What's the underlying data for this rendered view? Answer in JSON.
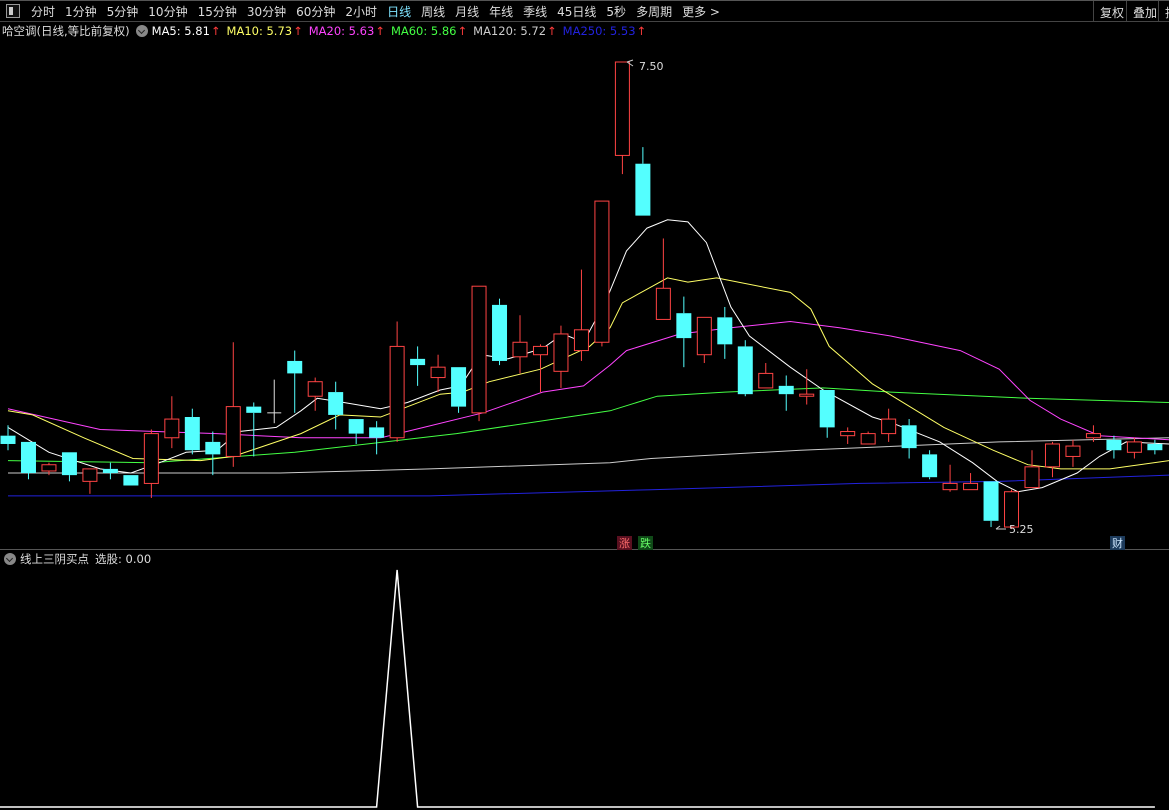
{
  "toolbar": {
    "periods": [
      "分时",
      "1分钟",
      "5分钟",
      "10分钟",
      "15分钟",
      "30分钟",
      "60分钟",
      "2小时",
      "日线",
      "周线",
      "月线",
      "年线",
      "季线",
      "45日线",
      "5秒",
      "多周期",
      "更多 >"
    ],
    "active_period": "日线",
    "right_buttons": [
      "复权",
      "叠加",
      "指"
    ]
  },
  "legend": {
    "title": "哈空调(日线,等比前复权)",
    "ma": [
      {
        "label": "MA5: 5.81",
        "color": "#ffffff"
      },
      {
        "label": "MA10: 5.73",
        "color": "#ffff66"
      },
      {
        "label": "MA20: 5.63",
        "color": "#ff44ff"
      },
      {
        "label": "MA60: 5.86",
        "color": "#44ff44"
      },
      {
        "label": "MA120: 5.72",
        "color": "#cccccc"
      },
      {
        "label": "MA250: 5.53",
        "color": "#2222dd"
      }
    ],
    "arrow": "↑"
  },
  "annotations": {
    "high": "7.50",
    "low": "5.25",
    "rise": "涨",
    "fall": "跌",
    "finance": "财"
  },
  "sub_legend": {
    "name": "线上三阴买点",
    "value": "选股: 0.00"
  },
  "colors": {
    "up": "#ff4444",
    "down": "#54ffff",
    "doji": "#dddddd"
  },
  "chart_data": {
    "type": "candlestick",
    "price_range": [
      5.25,
      7.5
    ],
    "candles": [
      [
        5.7,
        5.75,
        5.63,
        5.66
      ],
      [
        5.67,
        5.67,
        5.49,
        5.52
      ],
      [
        5.53,
        5.57,
        5.51,
        5.56
      ],
      [
        5.62,
        5.62,
        5.48,
        5.51
      ],
      [
        5.48,
        5.54,
        5.42,
        5.54
      ],
      [
        5.54,
        5.57,
        5.49,
        5.52
      ],
      [
        5.51,
        5.51,
        5.46,
        5.46
      ],
      [
        5.47,
        5.73,
        5.4,
        5.71
      ],
      [
        5.69,
        5.89,
        5.64,
        5.78
      ],
      [
        5.79,
        5.83,
        5.61,
        5.63
      ],
      [
        5.67,
        5.72,
        5.51,
        5.61
      ],
      [
        5.6,
        6.15,
        5.55,
        5.84
      ],
      [
        5.84,
        5.86,
        5.6,
        5.81
      ],
      [
        5.81,
        5.97,
        5.76,
        5.81
      ],
      [
        6.06,
        6.11,
        5.81,
        6.0
      ],
      [
        5.89,
        5.98,
        5.82,
        5.96
      ],
      [
        5.91,
        5.96,
        5.73,
        5.8
      ],
      [
        5.78,
        5.78,
        5.66,
        5.71
      ],
      [
        5.74,
        5.77,
        5.61,
        5.69
      ],
      [
        5.69,
        6.25,
        5.67,
        6.13
      ],
      [
        6.07,
        6.13,
        5.94,
        6.04
      ],
      [
        5.98,
        6.09,
        5.91,
        6.03
      ],
      [
        6.03,
        6.03,
        5.81,
        5.84
      ],
      [
        5.81,
        6.42,
        5.77,
        6.42
      ],
      [
        6.33,
        6.36,
        6.04,
        6.06
      ],
      [
        6.08,
        6.28,
        6.0,
        6.15
      ],
      [
        6.09,
        6.14,
        5.91,
        6.13
      ],
      [
        6.01,
        6.23,
        5.93,
        6.19
      ],
      [
        6.11,
        6.5,
        6.06,
        6.21
      ],
      [
        6.15,
        6.83,
        6.13,
        6.83
      ],
      [
        7.05,
        7.5,
        6.96,
        7.5
      ],
      [
        7.01,
        7.09,
        6.76,
        6.76
      ],
      [
        6.26,
        6.65,
        6.26,
        6.41
      ],
      [
        6.29,
        6.37,
        6.03,
        6.17
      ],
      [
        6.09,
        6.27,
        6.05,
        6.27
      ],
      [
        6.27,
        6.32,
        6.07,
        6.14
      ],
      [
        6.13,
        6.16,
        5.89,
        5.9
      ],
      [
        5.93,
        6.05,
        5.93,
        6.0
      ],
      [
        5.94,
        5.99,
        5.82,
        5.9
      ],
      [
        5.89,
        6.02,
        5.85,
        5.9
      ],
      [
        5.92,
        5.92,
        5.69,
        5.74
      ],
      [
        5.7,
        5.74,
        5.66,
        5.72
      ],
      [
        5.66,
        5.72,
        5.66,
        5.71
      ],
      [
        5.71,
        5.83,
        5.67,
        5.78
      ],
      [
        5.75,
        5.78,
        5.59,
        5.64
      ],
      [
        5.61,
        5.63,
        5.49,
        5.5
      ],
      [
        5.44,
        5.56,
        5.43,
        5.47
      ],
      [
        5.44,
        5.52,
        5.44,
        5.47
      ],
      [
        5.48,
        5.48,
        5.26,
        5.29
      ],
      [
        5.26,
        5.44,
        5.25,
        5.43
      ],
      [
        5.45,
        5.63,
        5.45,
        5.55
      ],
      [
        5.55,
        5.67,
        5.5,
        5.66
      ],
      [
        5.6,
        5.68,
        5.55,
        5.65
      ],
      [
        5.69,
        5.75,
        5.67,
        5.71
      ],
      [
        5.68,
        5.7,
        5.59,
        5.63
      ],
      [
        5.62,
        5.69,
        5.59,
        5.67
      ],
      [
        5.66,
        5.68,
        5.61,
        5.63
      ]
    ],
    "ma_series": [
      {
        "name": "MA5",
        "color": "#ffffff",
        "points": [
          [
            0,
            5.74
          ],
          [
            2,
            5.62
          ],
          [
            4.5,
            5.54
          ],
          [
            6,
            5.52
          ],
          [
            7.4,
            5.57
          ],
          [
            8.7,
            5.62
          ],
          [
            10.2,
            5.63
          ],
          [
            11.3,
            5.72
          ],
          [
            13.1,
            5.74
          ],
          [
            14.3,
            5.82
          ],
          [
            15.1,
            5.88
          ],
          [
            16.4,
            5.86
          ],
          [
            18.2,
            5.83
          ],
          [
            19.5,
            5.86
          ],
          [
            21.1,
            5.92
          ],
          [
            22.1,
            5.94
          ],
          [
            23.1,
            6.09
          ],
          [
            24.4,
            6.07
          ],
          [
            26.1,
            6.12
          ],
          [
            27.1,
            6.19
          ],
          [
            28.1,
            6.15
          ],
          [
            29.2,
            6.35
          ],
          [
            30.2,
            6.59
          ],
          [
            31.2,
            6.7
          ],
          [
            32.2,
            6.74
          ],
          [
            33.2,
            6.73
          ],
          [
            34.1,
            6.63
          ],
          [
            35.3,
            6.32
          ],
          [
            36.2,
            6.18
          ],
          [
            38.2,
            6.03
          ],
          [
            39.8,
            5.92
          ],
          [
            42.2,
            5.79
          ],
          [
            43.2,
            5.76
          ],
          [
            45.5,
            5.67
          ],
          [
            47.1,
            5.57
          ],
          [
            48.3,
            5.48
          ],
          [
            49.3,
            5.43
          ],
          [
            50.5,
            5.45
          ],
          [
            52.2,
            5.52
          ],
          [
            53.3,
            5.6
          ],
          [
            54.6,
            5.67
          ],
          [
            56.7,
            5.66
          ]
        ]
      },
      {
        "name": "MA10",
        "color": "#ffff66",
        "points": [
          [
            0,
            5.82
          ],
          [
            1.2,
            5.8
          ],
          [
            3.7,
            5.69
          ],
          [
            6.1,
            5.59
          ],
          [
            9.4,
            5.58
          ],
          [
            11,
            5.6
          ],
          [
            13.1,
            5.67
          ],
          [
            14.3,
            5.71
          ],
          [
            16.2,
            5.8
          ],
          [
            18.2,
            5.79
          ],
          [
            21.1,
            5.9
          ],
          [
            22.2,
            5.91
          ],
          [
            23.5,
            5.96
          ],
          [
            26,
            6.02
          ],
          [
            28.4,
            6.13
          ],
          [
            29.4,
            6.22
          ],
          [
            30,
            6.34
          ],
          [
            32.2,
            6.46
          ],
          [
            33.2,
            6.44
          ],
          [
            34.6,
            6.46
          ],
          [
            38.2,
            6.39
          ],
          [
            39.2,
            6.31
          ],
          [
            40.1,
            6.13
          ],
          [
            42.2,
            5.95
          ],
          [
            43.2,
            5.89
          ],
          [
            45.7,
            5.74
          ],
          [
            48.1,
            5.63
          ],
          [
            49.8,
            5.56
          ],
          [
            51.4,
            5.54
          ],
          [
            53.8,
            5.54
          ],
          [
            56.7,
            5.58
          ]
        ]
      },
      {
        "name": "MA20",
        "color": "#ff44ff",
        "points": [
          [
            0,
            5.83
          ],
          [
            4.5,
            5.73
          ],
          [
            10.2,
            5.71
          ],
          [
            14.3,
            5.69
          ],
          [
            18.2,
            5.69
          ],
          [
            20.3,
            5.74
          ],
          [
            23.2,
            5.81
          ],
          [
            26.1,
            5.91
          ],
          [
            28.1,
            5.94
          ],
          [
            29.4,
            6.04
          ],
          [
            30.2,
            6.11
          ],
          [
            32.8,
            6.19
          ],
          [
            35.3,
            6.22
          ],
          [
            38.2,
            6.25
          ],
          [
            40.6,
            6.22
          ],
          [
            43.1,
            6.18
          ],
          [
            46.5,
            6.11
          ],
          [
            48.4,
            6.02
          ],
          [
            49.9,
            5.87
          ],
          [
            51.4,
            5.78
          ],
          [
            53.3,
            5.7
          ],
          [
            56.7,
            5.68
          ]
        ]
      },
      {
        "name": "MA60",
        "color": "#44ff44",
        "points": [
          [
            0,
            5.58
          ],
          [
            7,
            5.57
          ],
          [
            14,
            5.62
          ],
          [
            21.9,
            5.71
          ],
          [
            29.4,
            5.82
          ],
          [
            31.7,
            5.89
          ],
          [
            35,
            5.91
          ],
          [
            39.8,
            5.93
          ],
          [
            43.1,
            5.91
          ],
          [
            49.8,
            5.88
          ],
          [
            56.7,
            5.86
          ]
        ]
      },
      {
        "name": "MA120",
        "color": "#cccccc",
        "points": [
          [
            0,
            5.52
          ],
          [
            13.3,
            5.52
          ],
          [
            20.6,
            5.54
          ],
          [
            29.4,
            5.57
          ],
          [
            31.4,
            5.59
          ],
          [
            38.7,
            5.63
          ],
          [
            48.4,
            5.67
          ],
          [
            56.7,
            5.69
          ]
        ]
      },
      {
        "name": "MA250",
        "color": "#2222dd",
        "points": [
          [
            0,
            5.41
          ],
          [
            6.4,
            5.41
          ],
          [
            20.6,
            5.41
          ],
          [
            31.4,
            5.44
          ],
          [
            41.6,
            5.47
          ],
          [
            48.4,
            5.48
          ],
          [
            56.7,
            5.51
          ]
        ]
      }
    ],
    "indicator": {
      "name": "线上三阴买点",
      "range": [
        0,
        1
      ],
      "signal_index": 19,
      "signal_value": 1
    }
  }
}
